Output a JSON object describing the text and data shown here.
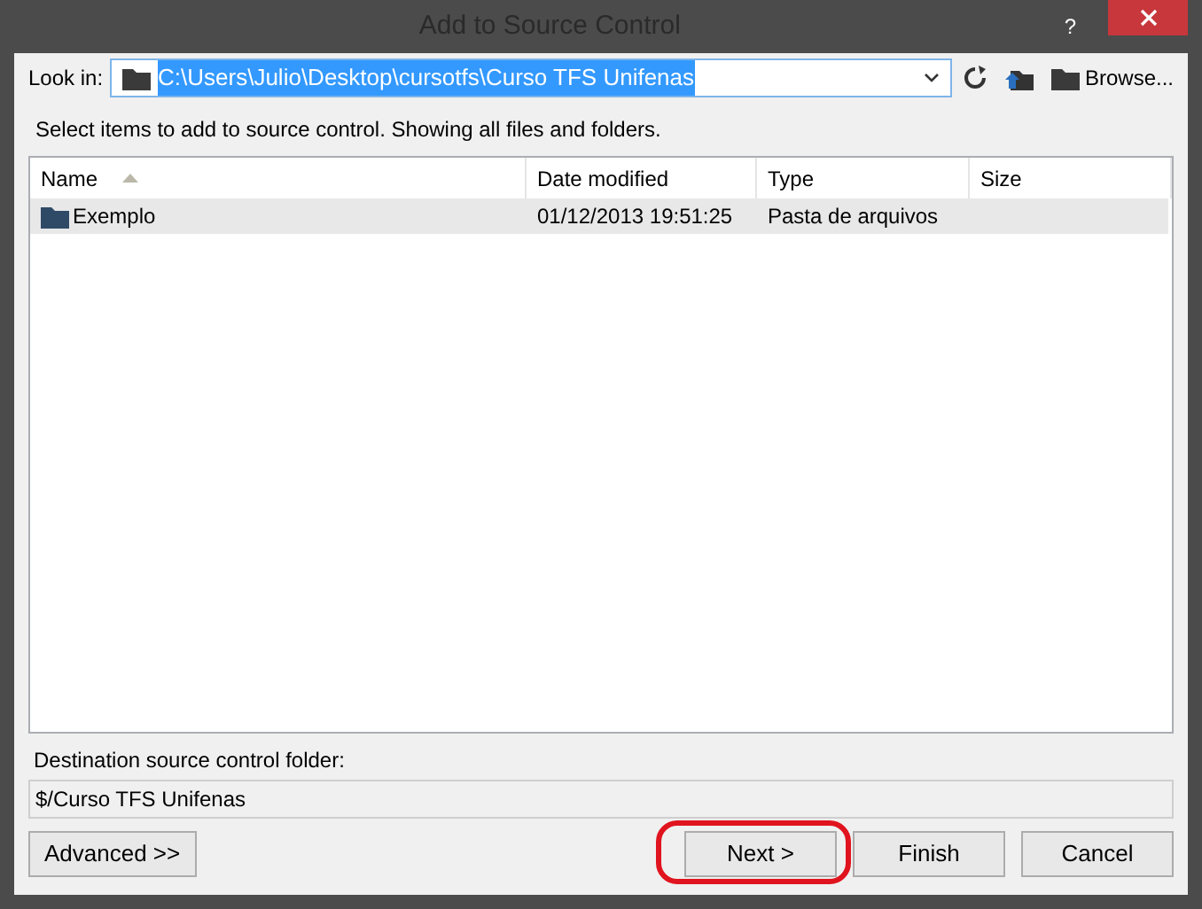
{
  "window": {
    "title": "Add to Source Control",
    "help": "?"
  },
  "look_in": {
    "label": "Look in:",
    "value": "C:\\Users\\Julio\\Desktop\\cursotfs\\Curso TFS Unifenas",
    "browse": "Browse..."
  },
  "instructions": "Select items to add to source control. Showing all files and folders.",
  "table": {
    "columns": [
      {
        "label": "Name",
        "sorted": true
      },
      {
        "label": "Date modified",
        "sorted": false
      },
      {
        "label": "Type",
        "sorted": false
      },
      {
        "label": "Size",
        "sorted": false
      }
    ],
    "rows": [
      {
        "name": "Exemplo",
        "date": "01/12/2013 19:51:25",
        "type": "Pasta de arquivos",
        "selected": true
      }
    ]
  },
  "destination": {
    "label": "Destination source control folder:",
    "value": "$/Curso TFS Unifenas"
  },
  "buttons": [
    {
      "label": "Advanced >>",
      "kind": "left",
      "highlighted": false
    },
    {
      "label": "Next >",
      "kind": "right",
      "highlighted": true
    },
    {
      "label": "Finish",
      "kind": "right",
      "highlighted": false
    },
    {
      "label": "Cancel",
      "kind": "right",
      "highlighted": false
    }
  ]
}
